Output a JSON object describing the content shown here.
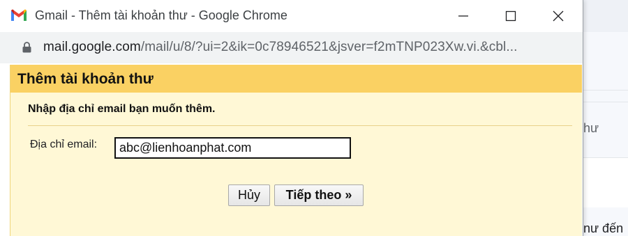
{
  "window": {
    "title": "Gmail - Thêm tài khoản thư - Google Chrome",
    "url_domain": "mail.google.com",
    "url_path": "/mail/u/8/?ui=2&ik=0c78946521&jsver=f2mTNP023Xw.vi.&cbl..."
  },
  "dialog": {
    "title": "Thêm tài khoản thư",
    "subtitle": "Nhập địa chỉ email bạn muốn thêm.",
    "email_label": "Địa chỉ email:",
    "email_value": "abc@lienhoanphat.com",
    "cancel_label": "Hủy",
    "next_label": "Tiếp theo »"
  },
  "background": {
    "text1": "hư",
    "text2": "nư đến"
  },
  "colors": {
    "dialog_header": "#fad163",
    "dialog_body": "#fff8d6",
    "address_bar": "#f1f3f4"
  }
}
